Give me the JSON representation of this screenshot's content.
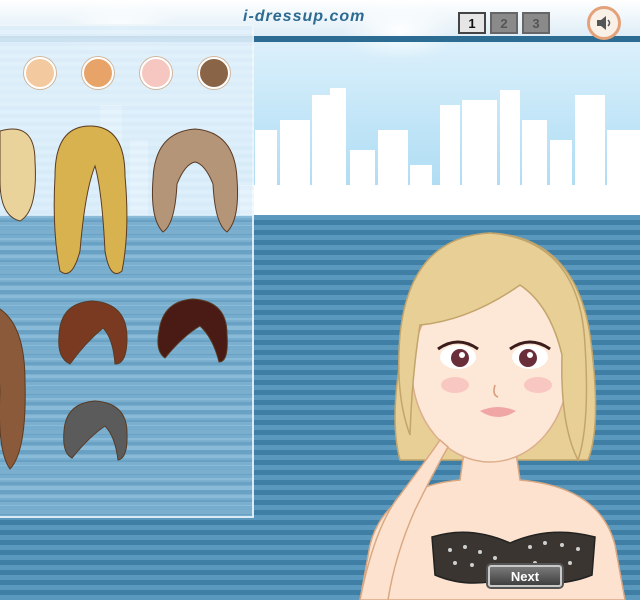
{
  "site_name": "i-dressup.com",
  "pages": [
    "1",
    "2",
    "3"
  ],
  "active_page": "1",
  "sound_icon": "speaker-icon",
  "next_label": "Next",
  "skin_tones": [
    "#f3c9a0",
    "#e8a468",
    "#f6c6c0",
    "#8a6446"
  ],
  "hair_colors": [
    "#e9d39b",
    "#d8b24e",
    "#b49578",
    "#8b5a3a",
    "#7a3a22",
    "#4a1a14",
    "#5b5b5b"
  ],
  "model_hair_color": "#e8cf96"
}
